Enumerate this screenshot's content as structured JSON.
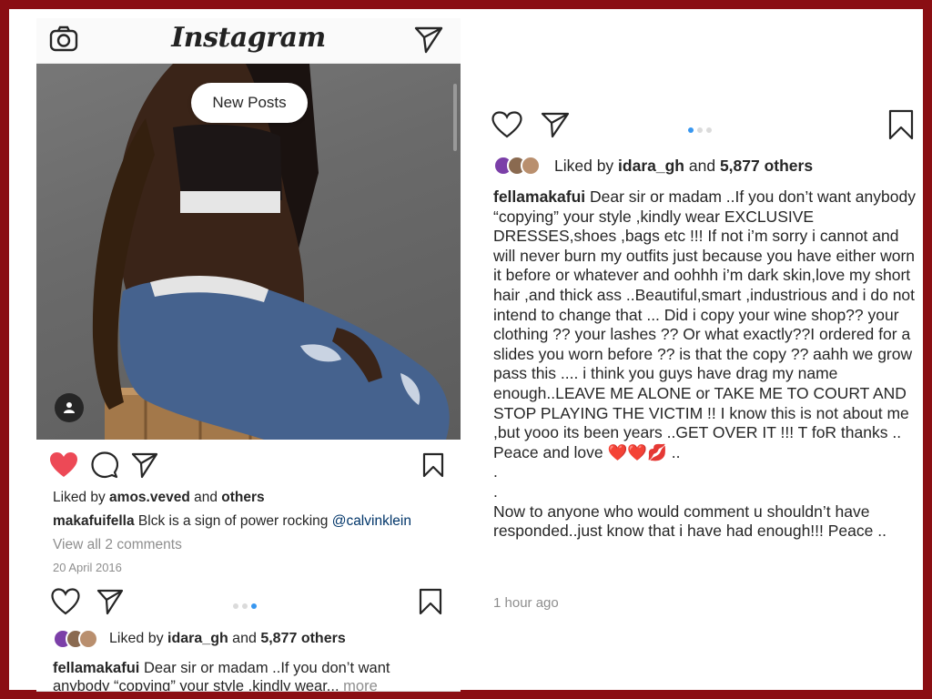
{
  "header": {
    "logo_text": "Instagram",
    "camera_icon": "camera-icon",
    "direct_icon": "paper-plane-icon"
  },
  "post1": {
    "new_posts_label": "New Posts",
    "liked_by_prefix": "Liked by ",
    "liked_by_user": "amos.veved",
    "liked_by_suffix": " and ",
    "liked_by_others": "others",
    "caption_user": "makafuifella",
    "caption_text": " Blck is a sign of power rocking ",
    "caption_mention": "@calvinklein",
    "view_comments": "View all 2 comments",
    "date": "20 April 2016",
    "liked": true
  },
  "post2": {
    "liked_by_prefix": "Liked by ",
    "liked_by_user": "idara_gh",
    "liked_by_mid": " and ",
    "liked_by_count": "5,877 others",
    "caption_user": "fellamakafui",
    "caption_preview": " Dear sir or madam ..If you don’t want anybody “copying” your style ,kindly wear...",
    "more_label": " more",
    "carousel_active_index": 2,
    "carousel_count": 3
  },
  "right_post": {
    "liked_by_prefix": "Liked by ",
    "liked_by_user": "idara_gh",
    "liked_by_mid": " and ",
    "liked_by_count": "5,877 others",
    "caption_user": "fellamakafui",
    "caption_text": " Dear sir or madam ..If you don’t want anybody “copying” your style ,kindly wear EXCLUSIVE DRESSES,shoes ,bags etc !!! If not i’m sorry i cannot and will never burn my outfits just because you have either worn it before or whatever and oohhh i’m dark skin,love my short hair ,and thick ass ..Beautiful,smart ,industrious and i do not intend to change that ... Did i copy your wine shop?? your clothing ?? your lashes ?? Or what exactly??I ordered for a slides you worn before ?? is that the copy ?? aahh we grow pass this .... i think you guys have drag my name enough..LEAVE ME ALONE or TAKE ME TO COURT AND STOP PLAYING THE VICTIM !! I know this is not about me ,but yooo its been years ..GET OVER IT !!! T foR thanks .. Peace and love ❤️❤️💋 ..\n.\n.\nNow to anyone who would comment u shouldn’t have responded..just know that i have had enough!!! Peace ..",
    "time": "1 hour ago",
    "carousel_active_index": 0,
    "carousel_count": 3
  },
  "colors": {
    "border": "#8a0e13",
    "like_red": "#ed4956",
    "active_dot": "#3897f0",
    "muted_text": "#8e8e8e",
    "mention": "#003569"
  }
}
